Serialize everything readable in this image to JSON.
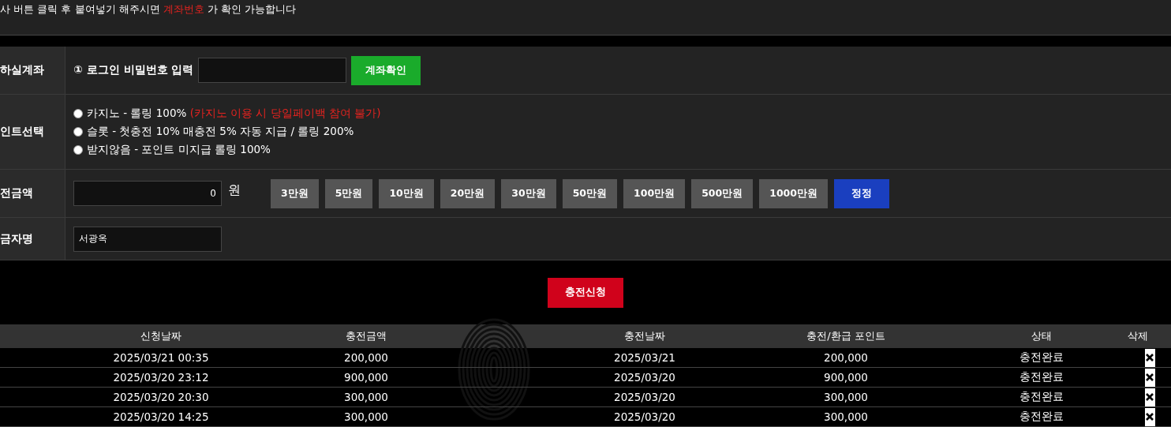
{
  "notice": {
    "before": "사 버튼 클릭 후 붙여넣기 해주시면 ",
    "highlight": "계좌번호",
    "after": " 가 확인 가능합니다"
  },
  "form": {
    "account": {
      "label": "하실계좌",
      "marker": "①",
      "prompt": "로그인 비밀번호 입력",
      "button": "계좌확인"
    },
    "bonus": {
      "label": "인트선택",
      "options": [
        {
          "text": "카지노 - 롤링 100% ",
          "note": "(카지노 이용 시 당일페이백 참여 불가)",
          "selected": false
        },
        {
          "text": "슬롯 - 첫충전 10% 매충전 5% 자동 지급 / 롤링 200%",
          "selected": false
        },
        {
          "text": "받지않음 - 포인트 미지급 롤링 100%",
          "selected": false
        }
      ]
    },
    "amount": {
      "label": "전금액",
      "value": "0",
      "unit": "원",
      "presets": [
        "3만원",
        "5만원",
        "10만원",
        "20만원",
        "30만원",
        "50만원",
        "100만원",
        "500만원",
        "1000만원"
      ],
      "reset": "정정"
    },
    "depositor": {
      "label": "금자명",
      "value": "서광옥"
    }
  },
  "submit": "충전신청",
  "table": {
    "columns": [
      "신청날짜",
      "충전금액",
      "",
      "충전날짜",
      "충전/환급 포인트",
      "상태",
      "삭제"
    ],
    "rows": [
      [
        "2025/03/21 00:35",
        "200,000",
        "",
        "2025/03/21",
        "200,000",
        "충전완료"
      ],
      [
        "2025/03/20 23:12",
        "900,000",
        "",
        "2025/03/20",
        "900,000",
        "충전완료"
      ],
      [
        "2025/03/20 20:30",
        "300,000",
        "",
        "2025/03/20",
        "300,000",
        "충전완료"
      ],
      [
        "2025/03/20 14:25",
        "300,000",
        "",
        "2025/03/20",
        "300,000",
        "충전완료"
      ]
    ]
  }
}
